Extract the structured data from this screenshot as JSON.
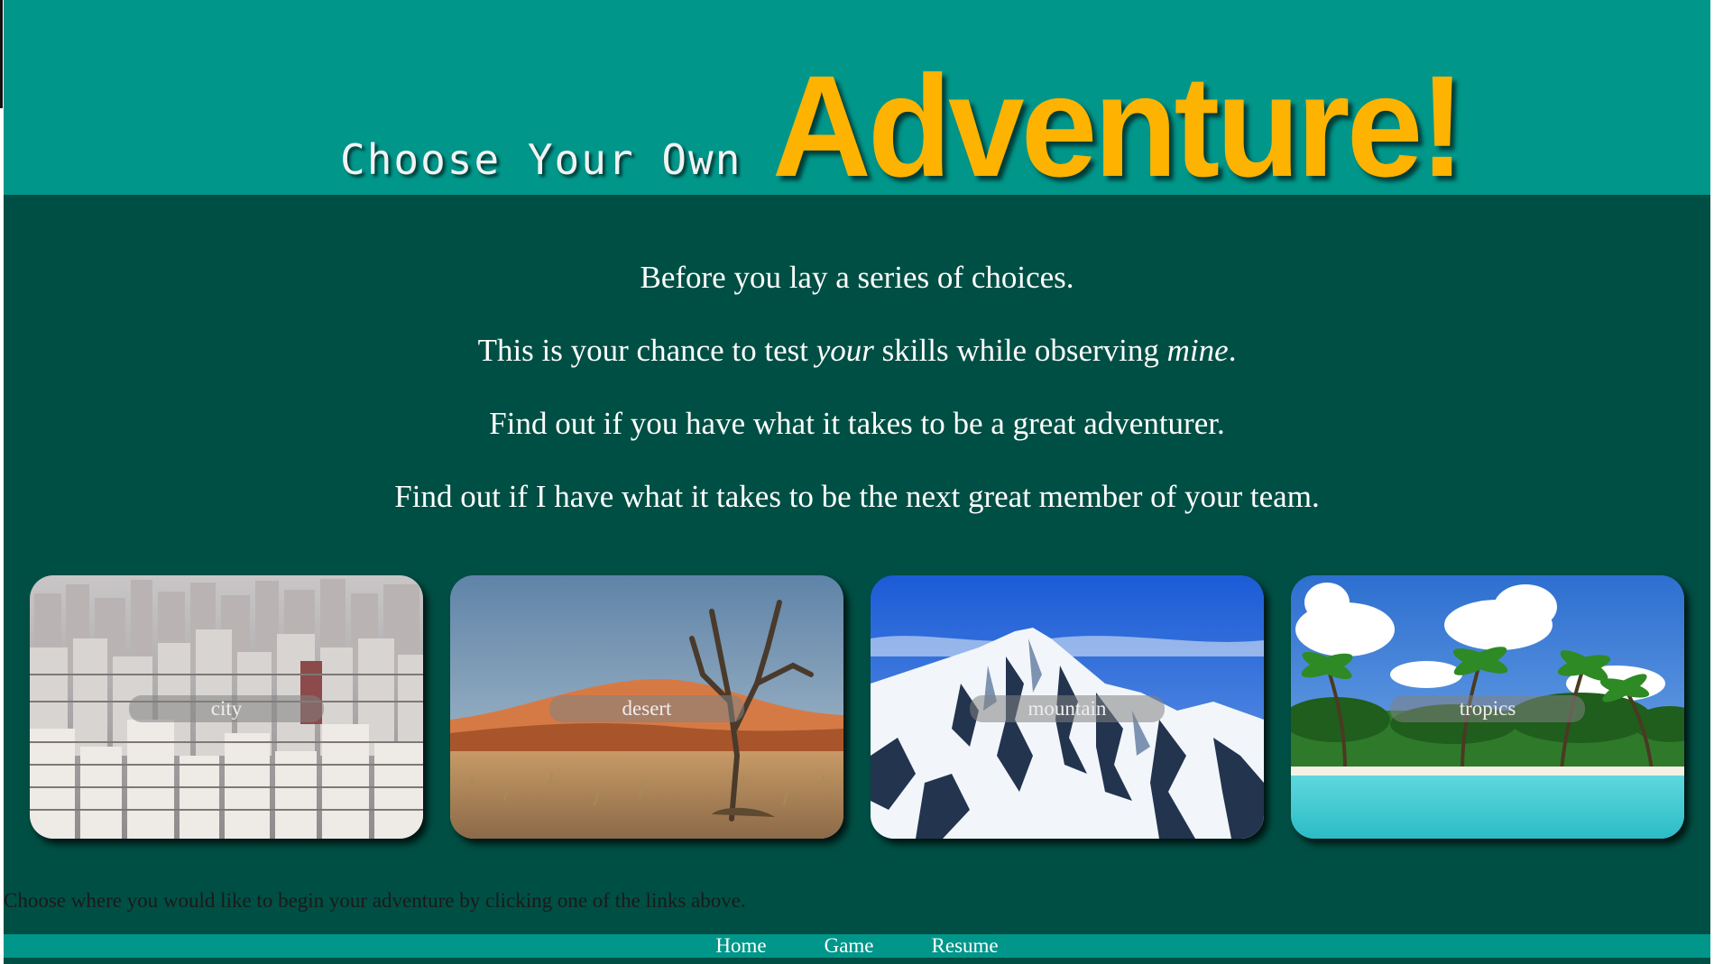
{
  "header": {
    "title_prefix": "Choose Your Own",
    "title_main": "Adventure!"
  },
  "intro": {
    "line1": "Before you lay a series of choices.",
    "line2_a": "This is your chance to test ",
    "line2_em1": "your",
    "line2_b": " skills while observing ",
    "line2_em2": "mine",
    "line2_c": ".",
    "line3": "Find out if you have what it takes to be a great adventurer.",
    "line4": "Find out if I have what it takes to be the next great member of your team."
  },
  "cards": [
    {
      "label": "city"
    },
    {
      "label": "desert"
    },
    {
      "label": "mountain"
    },
    {
      "label": "tropics"
    }
  ],
  "instruction": "Choose where you would like to begin your adventure by clicking one of the links above.",
  "footer": {
    "links": [
      "Home",
      "Game",
      "Resume"
    ]
  },
  "colors": {
    "header_bg": "#00968a",
    "body_bg": "#004f44",
    "title_accent": "#fdb300"
  }
}
